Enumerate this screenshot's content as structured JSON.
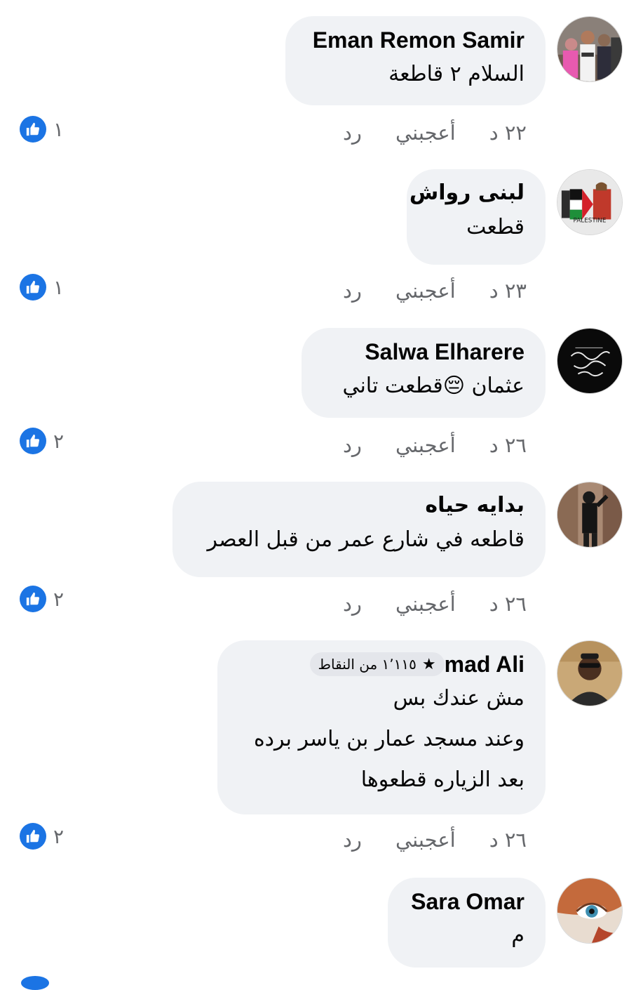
{
  "like_label": "أعجبني",
  "reply_label": "رد",
  "comments": [
    {
      "author": "Eman Remon Samir",
      "lines": [
        "السلام ٢ قاطعة"
      ],
      "time": "٢٢ د",
      "reactions": "١"
    },
    {
      "author": "لبنى رواش",
      "lines": [
        "قطعت"
      ],
      "time": "٢٣ د",
      "reactions": "١"
    },
    {
      "author": "Salwa Elharere",
      "lines": [
        "عثمان 😔قطعت تاني"
      ],
      "time": "٢٦ د",
      "reactions": "٢"
    },
    {
      "author": "بدايه حياه",
      "lines": [
        "قاطعه في شارع عمر من قبل العصر"
      ],
      "time": "٢٦ د",
      "reactions": "٢"
    },
    {
      "author": "mad Ali",
      "badge": "١٬١١٥ من النقاط",
      "lines": [
        "مش عندك بس",
        "وعند مسجد عمار بن ياسر برده",
        "بعد الزياره قطعوها"
      ],
      "time": "٢٦ د",
      "reactions": "٢"
    },
    {
      "author": "Sara Omar",
      "lines": [
        "م"
      ]
    }
  ],
  "avatar_icons": [
    "profile-photo-group",
    "palestine-flag-fist",
    "black-calligraphy",
    "woman-standing",
    "man-with-sunglasses",
    "painted-eye-face"
  ],
  "colors": {
    "bubble": "#f0f2f5",
    "meta_text": "#65676b",
    "like_blue": "#1b74e4",
    "text": "#050505"
  }
}
